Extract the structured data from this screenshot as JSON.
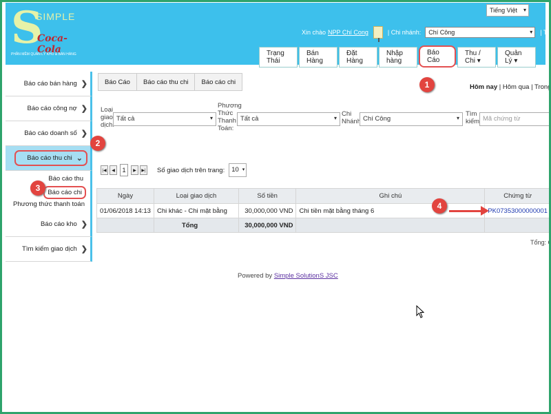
{
  "brand": {
    "simple": "SIMPLE",
    "coca": "Coca-Cola",
    "tagline": "PHẦN MỀM QUẢN LÝ KHO & BÁN HÀNG"
  },
  "language": "Tiếng Việt",
  "greeting": {
    "prefix": "Xin chào",
    "user": "NPP Chí Cong",
    "branch_label": "| Chi nhánh:",
    "branch_value": "Chí Công",
    "logout": "| Thoát"
  },
  "menu": [
    "Trạng Thái",
    "Bán Hàng",
    "Đặt Hàng",
    "Nhập hàng",
    "Báo Cáo",
    "Thu / Chi ▾",
    "Quản Lý ▾"
  ],
  "sidebar": {
    "items": [
      "Báo cáo bán hàng",
      "Báo cáo công nợ",
      "Báo cáo doanh số",
      "Báo cáo thu chi",
      "Báo cáo kho",
      "Tìm kiếm giao dịch"
    ],
    "sub": [
      "Báo cáo thu",
      "Báo cáo chi",
      "Phương thức thanh toán"
    ]
  },
  "breadcrumb": [
    "Báo Cáo",
    "Báo cáo thu chi",
    "Báo cáo chi"
  ],
  "quick": {
    "today": "Hôm nay",
    "sep1": " | ",
    "yesterday": "Hôm qua",
    "sep2": " | ",
    "month": "Trong tháng"
  },
  "filters": {
    "type_label": "Loại giao dịch:",
    "type_value": "Tất cả",
    "method_label": "Phương Thức Thanh Toán:",
    "method_value": "Tất cả",
    "branch_label": "Chi Nhánh:",
    "branch_value": "Chí Công",
    "search_label": "Tìm kiếm:",
    "search_placeholder": "Mã chứng từ"
  },
  "pager": {
    "page": "1",
    "pagesize_label": "Số giao dịch trên trang:",
    "pagesize": "10"
  },
  "table": {
    "headers": [
      "Ngày",
      "Loại giao dịch",
      "Số tiền",
      "Ghi chú",
      "Chứng từ"
    ],
    "row": {
      "date": "01/06/2018 14:13",
      "type": "Chi khác - Chi mặt bằng",
      "amount": "30,000,000 VND",
      "note": "Chi tiền mặt bằng tháng 6",
      "voucher": "PK07353000000001"
    },
    "total": {
      "label": "Tổng",
      "amount": "30,000,000 VND"
    }
  },
  "total_right": "Tổng: Ch",
  "powered": {
    "prefix": "Powered by",
    "link": "Simple SolutionS JSC"
  },
  "annotations": [
    "1",
    "2",
    "3",
    "4"
  ]
}
